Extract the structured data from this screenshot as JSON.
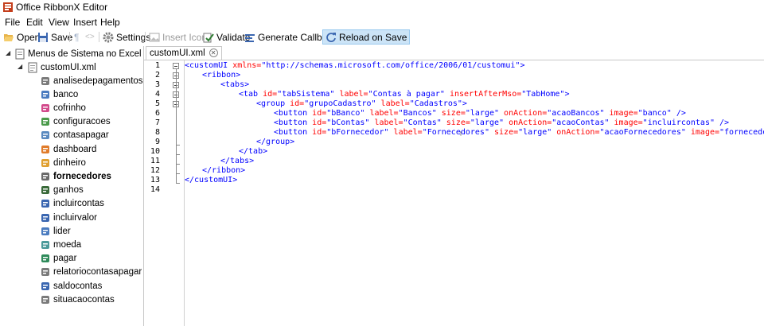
{
  "window": {
    "title": "Office RibbonX Editor"
  },
  "menu": [
    "File",
    "Edit",
    "View",
    "Insert",
    "Help"
  ],
  "toolbar": {
    "open": "Open",
    "save": "Save",
    "settings": "Settings",
    "insert_icons": "Insert Icons",
    "validate": "Validate",
    "generate_callbacks": "Generate Callbacks",
    "reload_on_save": "Reload on Save"
  },
  "tree": {
    "root": "Menus de Sistema no Excel - Ribb",
    "file": "customUI.xml",
    "items": [
      "analisedepagamentos",
      "banco",
      "cofrinho",
      "configuracoes",
      "contasapagar",
      "dashboard",
      "dinheiro",
      "fornecedores",
      "ganhos",
      "incluircontas",
      "incluirvalor",
      "lider",
      "moeda",
      "pagar",
      "relatoriocontasapagar",
      "saldocontas",
      "situacaocontas"
    ],
    "selected_index": 7
  },
  "editor": {
    "tab_label": "customUI.xml",
    "line_numbers": [
      "1",
      "2",
      "3",
      "4",
      "5",
      "6",
      "7",
      "8",
      "9",
      "10",
      "11",
      "12",
      "13",
      "14"
    ]
  },
  "code": {
    "l1_tag": "<customUI",
    "l1_attr": " xmlns=",
    "l1_val": "\"http://schemas.microsoft.com/office/2006/01/customui\"",
    "l1_end": ">",
    "l2": "<ribbon>",
    "l3": "<tabs>",
    "l4_tag": "<tab",
    "l4_a1": " id=",
    "l4_v1": "\"tabSistema\"",
    "l4_a2": " label=",
    "l4_v2": "\"Contas à pagar\"",
    "l4_a3": " insertAfterMso=",
    "l4_v3": "\"TabHome\"",
    "l4_end": ">",
    "l5_tag": "<group",
    "l5_a1": " id=",
    "l5_v1": "\"grupoCadastro\"",
    "l5_a2": " label=",
    "l5_v2": "\"Cadastros\"",
    "l5_end": ">",
    "l6_tag": "<button",
    "l6_a1": " id=",
    "l6_v1": "\"bBanco\"",
    "l6_a2": " label=",
    "l6_v2": "\"Bancos\"",
    "l6_a3": " size=",
    "l6_v3": "\"large\"",
    "l6_a4": " onAction=",
    "l6_v4": "\"acaoBancos\"",
    "l6_a5": " image=",
    "l6_v5": "\"banco\"",
    "l6_end": " />",
    "l7_tag": "<button",
    "l7_a1": " id=",
    "l7_v1": "\"bContas\"",
    "l7_a2": " label=",
    "l7_v2": "\"Contas\"",
    "l7_a3": " size=",
    "l7_v3": "\"large\"",
    "l7_a4": " onAction=",
    "l7_v4": "\"acaoContas\"",
    "l7_a5": " image=",
    "l7_v5": "\"incluircontas\"",
    "l7_end": " />",
    "l8_tag": "<button",
    "l8_a1": " id=",
    "l8_v1": "\"bFornecedor\"",
    "l8_a2": " label=",
    "l8_v2": "\"Fornecedores\"",
    "l8_a3": " size=",
    "l8_v3": "\"large\"",
    "l8_a4": " onAction=",
    "l8_v4": "\"acaoFornecedores\"",
    "l8_a5": " image=",
    "l8_v5": "\"fornecedores\"",
    "l8_end": " />",
    "l9": "</group>",
    "l10": "</tab>",
    "l11": "</tabs>",
    "l12": "</ribbon>",
    "l13": "</customUI>"
  },
  "colors": {
    "tag": "#0000ff",
    "attr": "#ff0000",
    "value": "#0000ff",
    "selection": "#cce4f7"
  }
}
